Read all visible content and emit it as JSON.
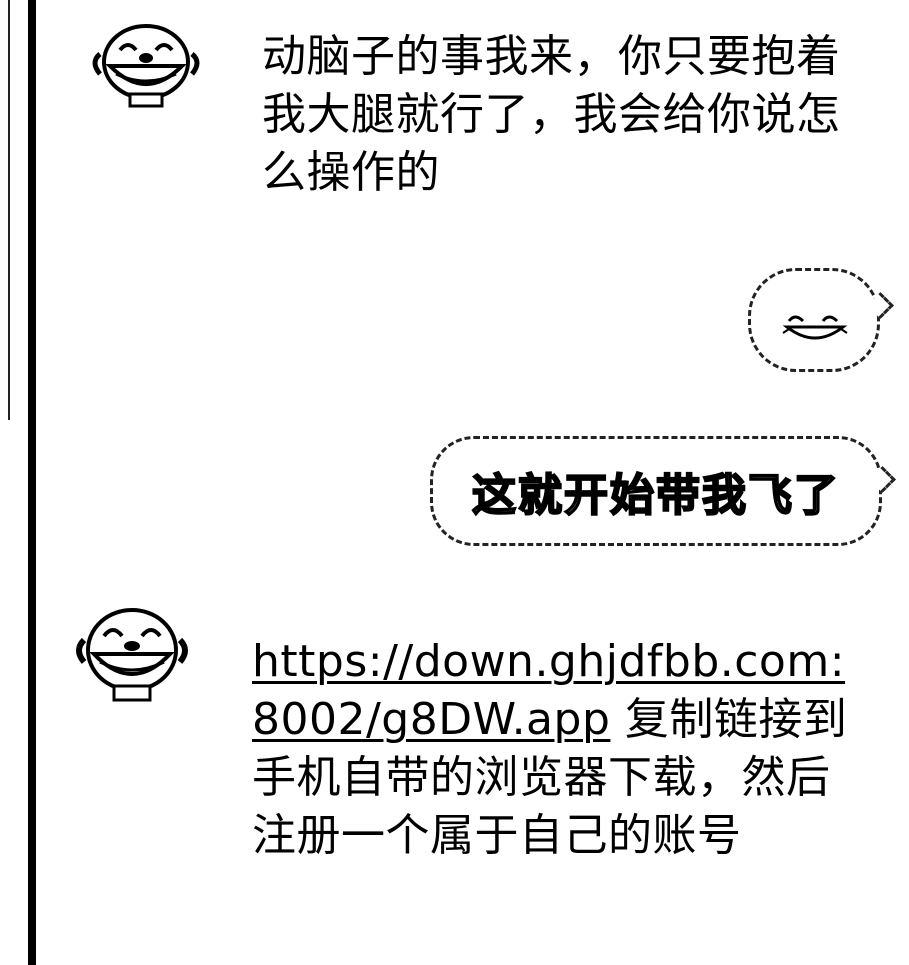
{
  "conversation": {
    "messages": [
      {
        "side": "received",
        "sender_icon": "laughing-face-icon",
        "text": "动脑子的事我来，你只要抱着我大腿就行了，我会给你说怎么操作的"
      },
      {
        "side": "sent",
        "sticker_icon": "laughing-emoji-icon"
      },
      {
        "side": "sent",
        "text": "这就开始带我飞了"
      },
      {
        "side": "received",
        "sender_icon": "laughing-face-icon",
        "link": "https://down.ghjdfbb.com:8002/g8DW.app",
        "text": " 复制链接到手机自带的浏览器下载，然后注册一个属于自己的账号"
      }
    ]
  },
  "colors": {
    "background": "#ffffff",
    "ink": "#000000"
  }
}
